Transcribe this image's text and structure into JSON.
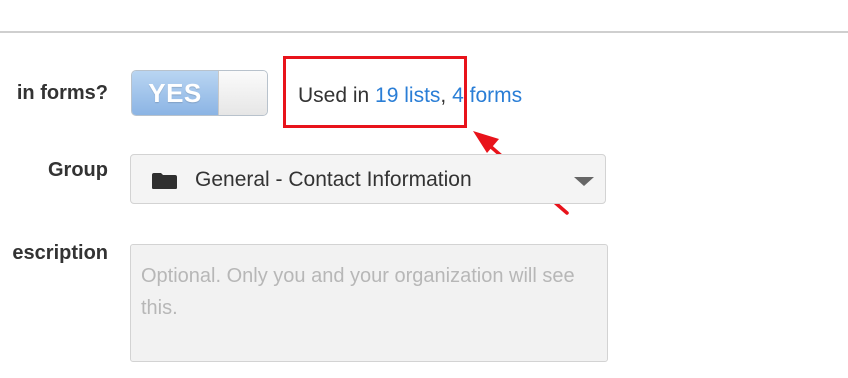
{
  "form": {
    "forms_label": "in forms?",
    "toggle_label": "YES",
    "usage": {
      "prefix": "Used in ",
      "lists_link": "19 lists",
      "separator": ",",
      "forms_link": "4 forms"
    },
    "group_label": "Group",
    "group_value": "General - Contact Information",
    "description_label": "escription",
    "description_placeholder": "Optional. Only you and your organization will see this."
  },
  "colors": {
    "link": "#2a7ed6",
    "toggle_on": "#8bb4e4",
    "annotation": "#e8131b"
  },
  "icons": {
    "folder": "folder-icon",
    "caret": "chevron-down-icon"
  }
}
